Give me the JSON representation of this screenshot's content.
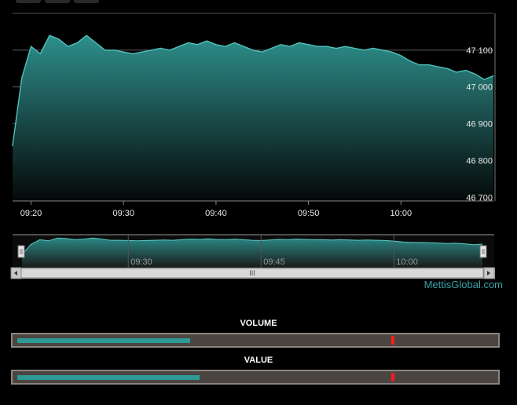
{
  "chart_data": {
    "type": "area",
    "x_ticks": [
      "09:20",
      "09:30",
      "09:40",
      "09:50",
      "10:00"
    ],
    "y_ticks": [
      "46 700",
      "46 800",
      "46 900",
      "47 000",
      "47 100"
    ],
    "ylim": [
      46690,
      47200
    ],
    "xlim": [
      "09:18",
      "10:10"
    ],
    "grid": true,
    "series": [
      {
        "x": [
          "09:18",
          "09:19",
          "09:20",
          "09:21",
          "09:22",
          "09:23",
          "09:24",
          "09:25",
          "09:26",
          "09:27",
          "09:28",
          "09:29",
          "09:30",
          "09:31",
          "09:32",
          "09:33",
          "09:34",
          "09:35",
          "09:36",
          "09:37",
          "09:38",
          "09:39",
          "09:40",
          "09:41",
          "09:42",
          "09:43",
          "09:44",
          "09:45",
          "09:46",
          "09:47",
          "09:48",
          "09:49",
          "09:50",
          "09:51",
          "09:52",
          "09:53",
          "09:54",
          "09:55",
          "09:56",
          "09:57",
          "09:58",
          "09:59",
          "10:00",
          "10:01",
          "10:02",
          "10:03",
          "10:04",
          "10:05",
          "10:06",
          "10:07",
          "10:08",
          "10:09",
          "10:10"
        ],
        "values": [
          46840,
          47025,
          47110,
          47090,
          47140,
          47130,
          47110,
          47120,
          47140,
          47120,
          47100,
          47100,
          47095,
          47090,
          47095,
          47100,
          47105,
          47100,
          47110,
          47120,
          47115,
          47125,
          47115,
          47110,
          47120,
          47110,
          47100,
          47095,
          47105,
          47115,
          47110,
          47120,
          47115,
          47110,
          47110,
          47105,
          47110,
          47105,
          47100,
          47105,
          47100,
          47095,
          47085,
          47070,
          47060,
          47060,
          47055,
          47050,
          47040,
          47045,
          47035,
          47020,
          47030
        ]
      }
    ]
  },
  "navigator": {
    "x_ticks": [
      "09:30",
      "09:45",
      "10:00"
    ],
    "scroll_grip": "III"
  },
  "credit": "MettisGlobal.com",
  "gauges": [
    {
      "label": "VOLUME",
      "fill": 0.36,
      "marker": 0.79
    },
    {
      "label": "VALUE",
      "fill": 0.38,
      "marker": 0.79
    }
  ],
  "colors": {
    "area_top": "#2e8f8c",
    "line": "#4fc3bd",
    "gauge_fill": "#2e9a96",
    "marker": "#ff1a1a"
  }
}
